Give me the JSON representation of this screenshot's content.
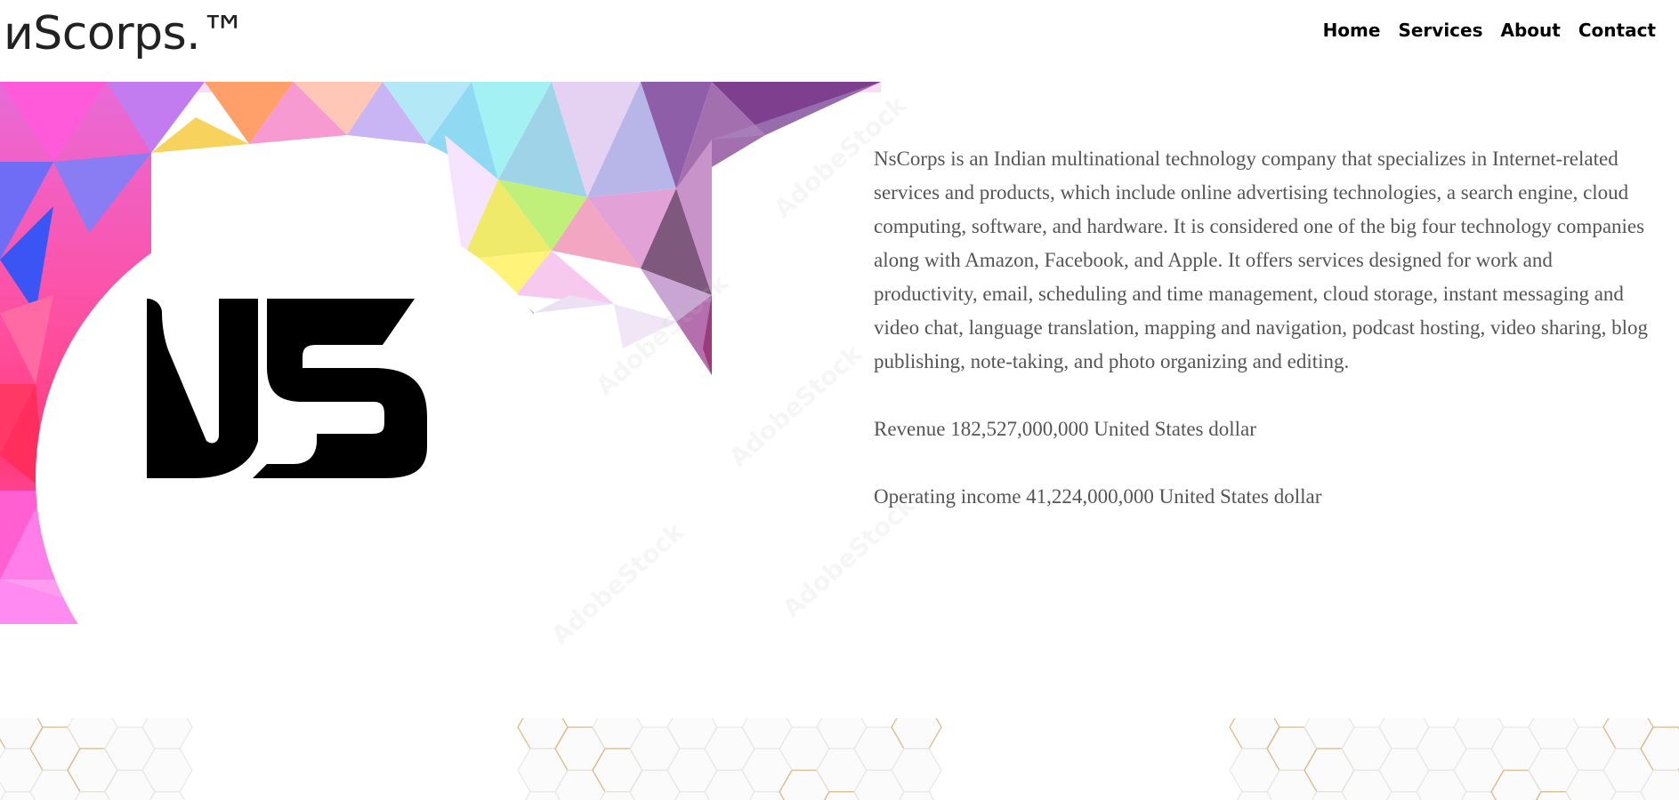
{
  "header": {
    "brand": "иScorps.™",
    "nav": [
      {
        "label": "Home"
      },
      {
        "label": "Services"
      },
      {
        "label": "About"
      },
      {
        "label": "Contact"
      }
    ]
  },
  "hero": {
    "logo_icon": "ns-logo-icon",
    "description": "NsCorps is an Indian multinational technology company that specializes in Internet-related services and products, which include online advertising technologies, a search engine, cloud computing, software, and hardware. It is considered one of the big four technology companies along with Amazon, Facebook, and Apple. It offers services designed for work and productivity, email, scheduling and time management, cloud storage, instant messaging and video chat, language translation, mapping and navigation, podcast hosting, video sharing, blog publishing, note-taking, and photo organizing and editing.",
    "revenue": "Revenue 182,527,000,000 United States dollar",
    "operating_income": "Operating income 41,224,000,000 United States dollar",
    "watermark": "AdobeStock"
  },
  "colors": {
    "brand_text": "#222222",
    "nav_text": "#000000",
    "body_text": "#555555",
    "accent_magenta": "#ff3fd8",
    "hex_gold": "#d9b98a"
  }
}
